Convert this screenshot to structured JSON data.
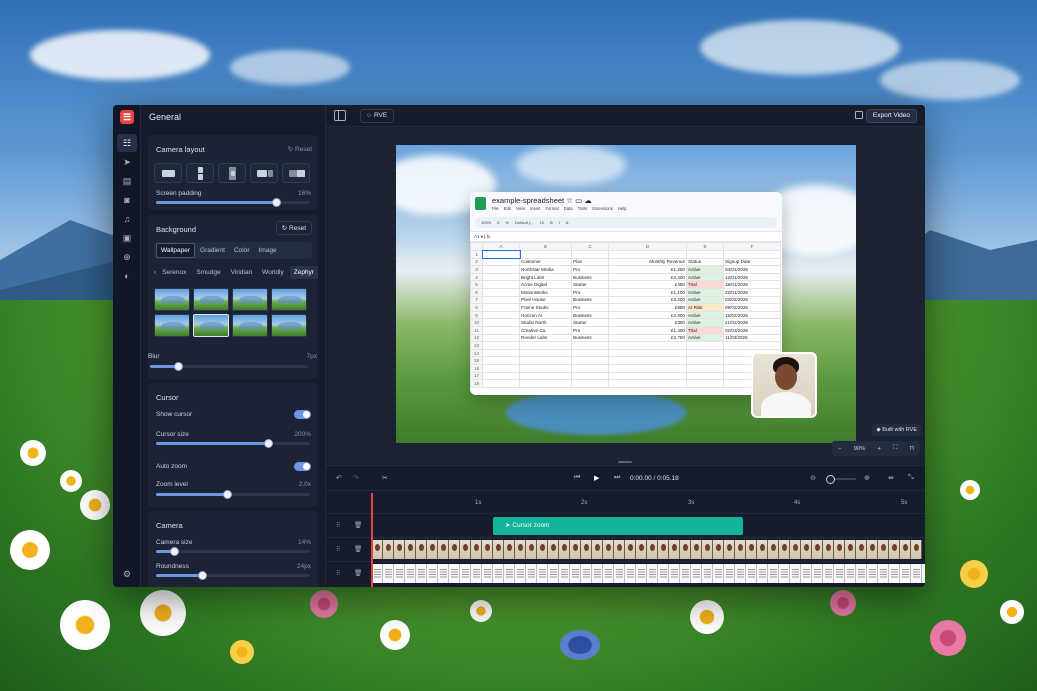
{
  "app": {
    "panel_title": "General",
    "project_name": "RVE",
    "export_label": "Export Video",
    "built_with": "Built with RVE"
  },
  "camera_layout": {
    "title": "Camera layout",
    "reset_label": "Reset",
    "screen_padding_label": "Screen padding",
    "screen_padding_value": "16%",
    "screen_padding_level": 0.78
  },
  "background": {
    "title": "Background",
    "reset_label": "Reset",
    "tabs": [
      "Wallpaper",
      "Gradient",
      "Color",
      "Image"
    ],
    "active_tab": "Wallpaper",
    "collections": [
      "Serenox",
      "Smudge",
      "Viridian",
      "Worldly",
      "Zephyr"
    ],
    "active_collection": "Zephyr",
    "blur_label": "Blur",
    "blur_value": "7px",
    "blur_level": 0.18
  },
  "cursor": {
    "title": "Cursor",
    "show_cursor_label": "Show cursor",
    "cursor_size_label": "Cursor size",
    "cursor_size_value": "200%",
    "cursor_size_level": 0.73,
    "auto_zoom_label": "Auto zoom",
    "zoom_level_label": "Zoom level",
    "zoom_level_value": "2.0x",
    "zoom_level_level": 0.46
  },
  "camera": {
    "title": "Camera",
    "camera_size_label": "Camera size",
    "camera_size_value": "14%",
    "camera_size_level": 0.12,
    "roundness_label": "Roundness",
    "roundness_value": "24px",
    "roundness_level": 0.3
  },
  "spreadsheet": {
    "title": "example-spreadsheet",
    "menu": [
      "File",
      "Edit",
      "View",
      "Insert",
      "Format",
      "Data",
      "Tools",
      "Extensions",
      "Help"
    ],
    "toolbar": [
      "100%",
      "£",
      "%",
      "Default (...",
      "10",
      "B",
      "I",
      "A"
    ],
    "cell_ref": "A1",
    "columns": [
      "A",
      "B",
      "C",
      "D",
      "E",
      "F"
    ],
    "header": [
      "Customer",
      "Plan",
      "Monthly Revenue",
      "Status",
      "Signup Date"
    ],
    "rows": [
      [
        "Northstar Media",
        "Pro",
        "£1,250",
        "Active",
        "04/01/2026"
      ],
      [
        "Bright Labs",
        "Business",
        "£2,400",
        "Active",
        "12/01/2026"
      ],
      [
        "Acme Digital",
        "Starter",
        "£450",
        "Trial",
        "18/01/2026"
      ],
      [
        "MotionWorks",
        "Pro",
        "£1,100",
        "Active",
        "22/01/2026"
      ],
      [
        "Pixel House",
        "Business",
        "£3,200",
        "Active",
        "03/02/2026"
      ],
      [
        "Frame Studio",
        "Pro",
        "£950",
        "At Risk",
        "09/02/2026"
      ],
      [
        "Horizon AI",
        "Business",
        "£2,800",
        "Active",
        "15/02/2026"
      ],
      [
        "Studio North",
        "Starter",
        "£350",
        "Active",
        "21/02/2026"
      ],
      [
        "Creative Co.",
        "Pro",
        "£1,400",
        "Trial",
        "02/03/2026"
      ],
      [
        "Render Labs",
        "Business",
        "£3,750",
        "Active",
        "11/03/2026"
      ]
    ],
    "row_numbers": [
      "1",
      "2",
      "3",
      "4",
      "5",
      "6",
      "7",
      "8",
      "9",
      "10",
      "11",
      "12",
      "13",
      "14",
      "15",
      "16",
      "17",
      "18"
    ]
  },
  "canvas": {
    "zoom_value": "90%"
  },
  "timeline": {
    "timecode": "0:00.00 / 0:05.18",
    "ticks": [
      "1s",
      "2s",
      "3s",
      "4s",
      "5s"
    ],
    "zoom_clip_label": "Cursor zoom"
  },
  "colors": {
    "accent": "#6f96e6",
    "brand": "#e54545",
    "zoom_clip": "#13b39b"
  }
}
